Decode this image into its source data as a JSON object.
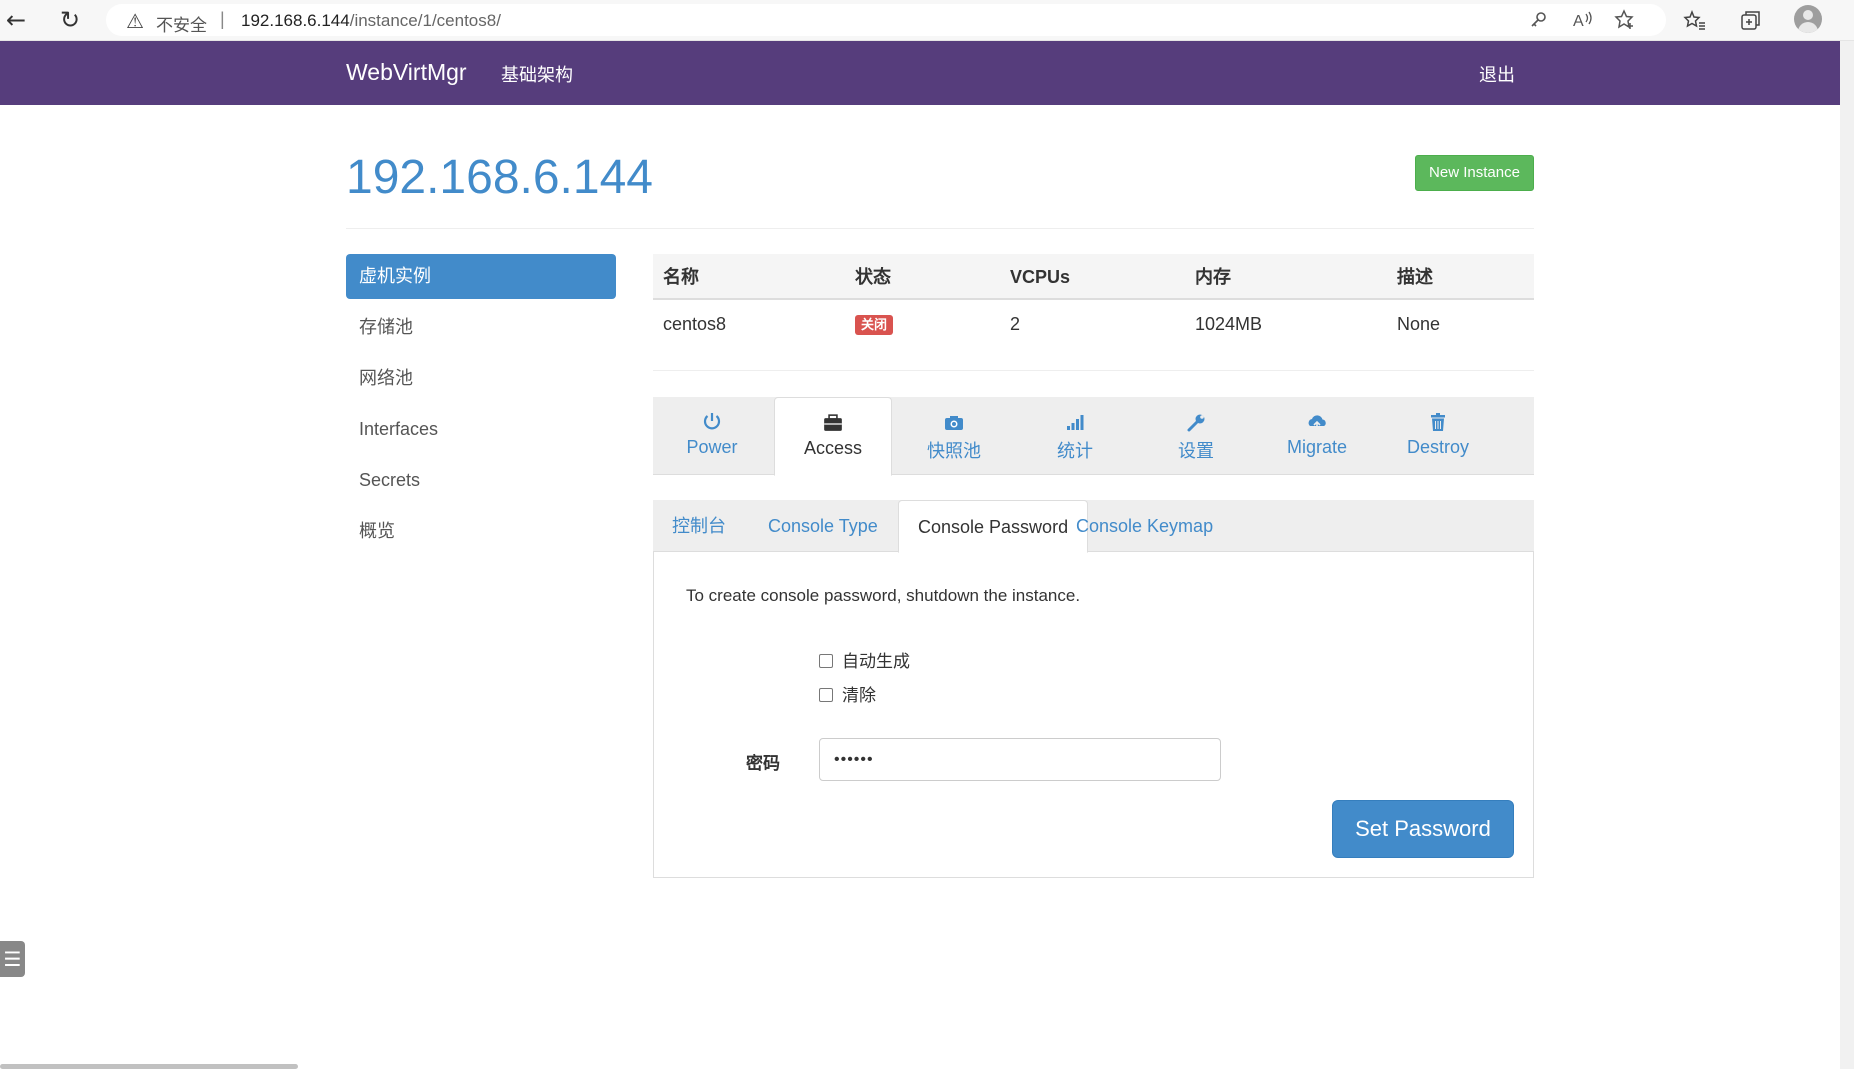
{
  "browser": {
    "back_icon": "←",
    "refresh_icon": "↻",
    "warning_icon": "⚠",
    "insecure_label": "不安全",
    "url_host": "192.168.6.144",
    "url_path": "/instance/1/centos8/"
  },
  "navbar": {
    "brand": "WebVirtMgr",
    "infrastructure": "基础架构",
    "logout": "退出",
    "bg_color": "#563d7c"
  },
  "header": {
    "title": "192.168.6.144",
    "new_instance": "New Instance"
  },
  "sidebar": {
    "items": [
      {
        "label": "虚机实例",
        "active": true
      },
      {
        "label": "存储池"
      },
      {
        "label": "网络池"
      },
      {
        "label": "Interfaces"
      },
      {
        "label": "Secrets"
      },
      {
        "label": "概览"
      }
    ]
  },
  "table": {
    "headers": [
      "名称",
      "状态",
      "VCPUs",
      "内存",
      "描述"
    ],
    "row": {
      "name": "centos8",
      "status": "关闭",
      "vcpus": "2",
      "memory": "1024MB",
      "description": "None"
    }
  },
  "actions": {
    "tabs": [
      {
        "label": "Power",
        "icon": "power-icon"
      },
      {
        "label": "Access",
        "icon": "briefcase-icon",
        "active": true
      },
      {
        "label": "快照池",
        "icon": "camera-icon"
      },
      {
        "label": "统计",
        "icon": "signal-icon"
      },
      {
        "label": "设置",
        "icon": "wrench-icon"
      },
      {
        "label": "Migrate",
        "icon": "cloud-upload-icon"
      },
      {
        "label": "Destroy",
        "icon": "trash-icon"
      }
    ]
  },
  "console": {
    "tabs": [
      {
        "label": "控制台"
      },
      {
        "label": "Console Type"
      },
      {
        "label": "Console Password",
        "active": true
      },
      {
        "label": "Console Keymap"
      }
    ],
    "message": "To create console password, shutdown the instance.",
    "auto_generate": "自动生成",
    "clear": "清除",
    "password_label": "密码",
    "password_value": "••••••",
    "set_password": "Set Password"
  }
}
